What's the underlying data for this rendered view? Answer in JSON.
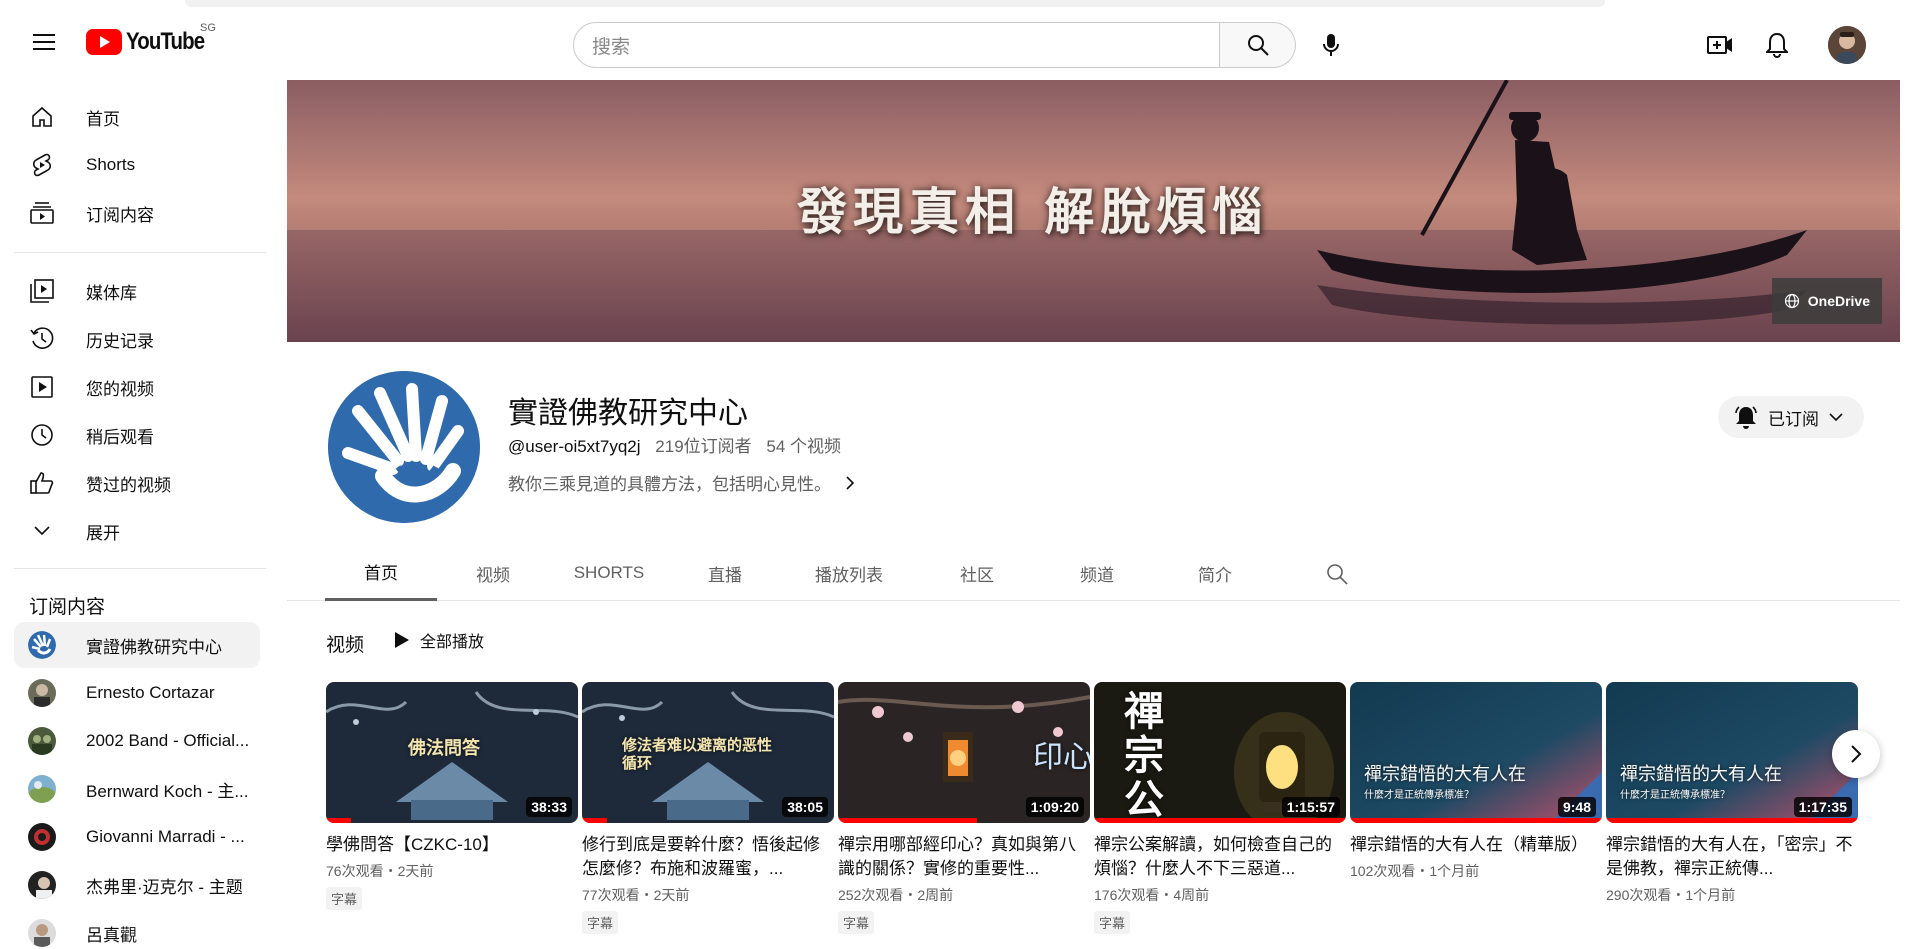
{
  "app": {
    "logo_text": "YouTube",
    "region": "SG"
  },
  "search": {
    "placeholder": "搜索"
  },
  "sidebar": {
    "items": [
      {
        "label": "首页",
        "icon": "home-icon"
      },
      {
        "label": "Shorts",
        "icon": "shorts-icon"
      },
      {
        "label": "订阅内容",
        "icon": "subscriptions-icon"
      },
      {
        "label": "媒体库",
        "icon": "library-icon"
      },
      {
        "label": "历史记录",
        "icon": "history-icon"
      },
      {
        "label": "您的视频",
        "icon": "your-videos-icon"
      },
      {
        "label": "稍后观看",
        "icon": "watch-later-icon"
      },
      {
        "label": "赞过的视频",
        "icon": "liked-videos-icon"
      },
      {
        "label": "展开",
        "icon": "chevron-down-icon"
      }
    ],
    "subscriptions_title": "订阅内容",
    "subscriptions": [
      {
        "label": "實證佛教研究中心"
      },
      {
        "label": "Ernesto Cortazar"
      },
      {
        "label": "2002 Band - Official..."
      },
      {
        "label": "Bernward Koch - 主..."
      },
      {
        "label": "Giovanni Marradi - ..."
      },
      {
        "label": "杰弗里·迈克尔 - 主题"
      },
      {
        "label": "呂真觀"
      }
    ]
  },
  "banner": {
    "text": "發現真相 解脫煩惱",
    "link_label": "OneDrive"
  },
  "channel": {
    "name": "實證佛教研究中心",
    "handle": "@user-oi5xt7yq2j",
    "subscribers": "219位订阅者",
    "videos_count": "54 个视频",
    "description": "教你三乘見道的具體方法，包括明心見性。",
    "subscribed_label": "已订阅"
  },
  "tabs": [
    "首页",
    "视频",
    "SHORTS",
    "直播",
    "播放列表",
    "社区",
    "频道",
    "简介"
  ],
  "shelf": {
    "title": "视频",
    "play_all": "全部播放"
  },
  "videos": [
    {
      "title": "學佛問答【CZKC-10】",
      "meta": "76次观看・2天前",
      "badge": "字幕",
      "duration": "38:33",
      "thumb_text": "佛法問答",
      "progress": 0.1
    },
    {
      "title": "修行到底是要幹什麼？悟後起修怎麼修？布施和波羅蜜，...",
      "meta": "77次观看・2天前",
      "badge": "字幕",
      "duration": "38:05",
      "thumb_text": "修法者难以避离的恶性循环",
      "progress": 0.1
    },
    {
      "title": "禪宗用哪部經印心？真如與第八識的關係？實修的重要性...",
      "meta": "252次观看・2周前",
      "badge": "字幕",
      "duration": "1:09:20",
      "thumb_text": "印心",
      "progress": 0.55
    },
    {
      "title": "禪宗公案解讀，如何檢查自己的煩惱？什麼人不下三惡道...",
      "meta": "176次观看・4周前",
      "badge": "字幕",
      "duration": "1:15:57",
      "thumb_text": "禪宗公案",
      "progress": 1.0
    },
    {
      "title": "禪宗錯悟的大有人在（精華版）",
      "meta": "102次观看・1个月前",
      "badge": "",
      "duration": "9:48",
      "thumb_text": "禪宗錯悟的大有人在",
      "thumb_sub": "什麼才是正統傳承標准？",
      "progress": 1.0
    },
    {
      "title": "禪宗錯悟的大有人在，「密宗」不是佛教，禪宗正統傳...",
      "meta": "290次观看・1个月前",
      "badge": "",
      "duration": "1:17:35",
      "thumb_text": "禪宗錯悟的大有人在",
      "thumb_sub": "什麼才是正統傳承標准？",
      "progress": 1.0
    }
  ]
}
